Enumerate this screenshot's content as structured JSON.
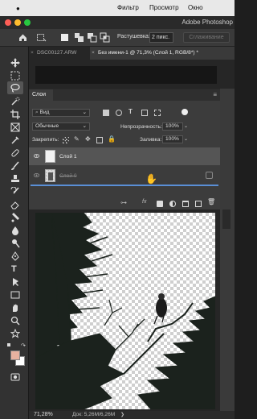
{
  "menubar": {
    "filter": "Фильтр",
    "view": "Просмотр",
    "window": "Окно"
  },
  "app": {
    "title": "Adobe Photoshop"
  },
  "options": {
    "feather_label": "Растушевка:",
    "feather_value": "2 пикс.",
    "smooth_label": "Сглаживание"
  },
  "tabs": [
    {
      "label": "DSC00127.ARW"
    },
    {
      "label": "Без имени-1 @ 71,3% (Слой 1, RGB/8*) *"
    }
  ],
  "layers": {
    "panel_title": "Слои",
    "filter_label": "Вид",
    "blend_mode": "Обычные",
    "opacity_label": "Непрозрачность:",
    "opacity_value": "100%",
    "lock_label": "Закрепить:",
    "fill_label": "Заливка:",
    "fill_value": "100%",
    "items": [
      {
        "name": "Слой 1"
      },
      {
        "name": "Слой 0"
      }
    ],
    "footer_fx": "fx"
  },
  "status": {
    "zoom": "71,28%",
    "doc": "Док: 5,26M/6,26M"
  },
  "colors": {
    "foreground": "#e7b2a0",
    "background": "#ffffff",
    "selected_layer": "#555555",
    "drag_line": "#5a8fd6"
  }
}
